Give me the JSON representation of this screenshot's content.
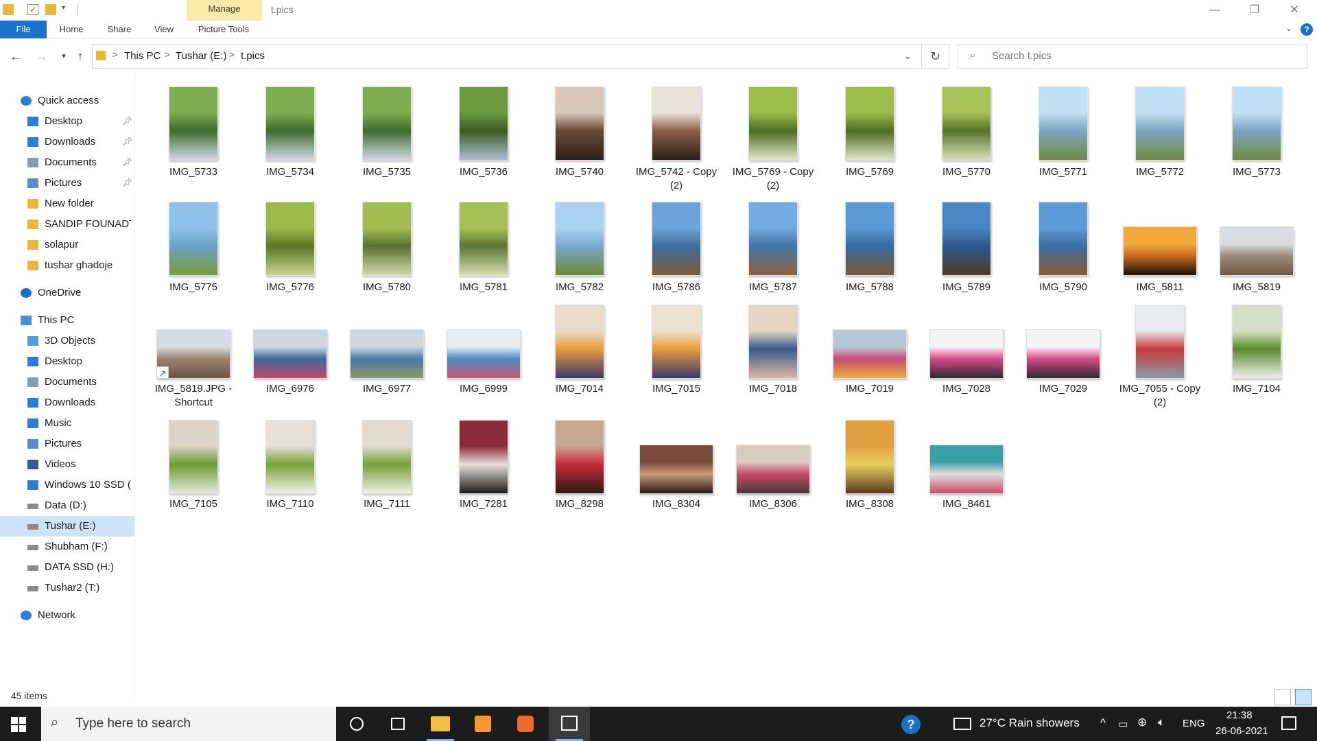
{
  "window": {
    "title": "t.pics",
    "manage_tab": "Manage",
    "controls": {
      "minimize": "—",
      "restore": "❐",
      "close": "✕"
    }
  },
  "ribbon": {
    "tabs": [
      "File",
      "Home",
      "Share",
      "View",
      "Picture Tools"
    ],
    "help": "?"
  },
  "address": {
    "crumbs": [
      "This PC",
      "Tushar (E:)",
      "t.pics"
    ],
    "separator": ">",
    "search_placeholder": "Search t.pics"
  },
  "sidebar": {
    "items": [
      {
        "label": "Quick access",
        "icon": "star-icon",
        "pinned": false
      },
      {
        "label": "Desktop",
        "icon": "desktop-icon",
        "pinned": true
      },
      {
        "label": "Downloads",
        "icon": "download-icon",
        "pinned": true
      },
      {
        "label": "Documents",
        "icon": "document-icon",
        "pinned": true
      },
      {
        "label": "Pictures",
        "icon": "pictures-icon",
        "pinned": true
      },
      {
        "label": "New folder",
        "icon": "folder-icon",
        "pinned": false
      },
      {
        "label": "SANDIP FOUNADTI(",
        "icon": "folder-icon",
        "pinned": false
      },
      {
        "label": "solapur",
        "icon": "folder-icon",
        "pinned": false
      },
      {
        "label": "tushar ghadoje",
        "icon": "folder-icon",
        "pinned": false
      },
      {
        "label": "OneDrive",
        "icon": "cloud-icon",
        "pinned": false
      },
      {
        "label": "This PC",
        "icon": "computer-icon",
        "pinned": false
      },
      {
        "label": "3D Objects",
        "icon": "cube-icon",
        "pinned": false
      },
      {
        "label": "Desktop",
        "icon": "desktop-icon",
        "pinned": false
      },
      {
        "label": "Documents",
        "icon": "document-icon",
        "pinned": false
      },
      {
        "label": "Downloads",
        "icon": "download-icon",
        "pinned": false
      },
      {
        "label": "Music",
        "icon": "music-icon",
        "pinned": false
      },
      {
        "label": "Pictures",
        "icon": "pictures-icon",
        "pinned": false
      },
      {
        "label": "Videos",
        "icon": "video-icon",
        "pinned": false
      },
      {
        "label": "Windows 10 SSD (C",
        "icon": "windows-drive-icon",
        "pinned": false
      },
      {
        "label": "Data (D:)",
        "icon": "drive-icon",
        "pinned": false
      },
      {
        "label": "Tushar (E:)",
        "icon": "drive-icon",
        "pinned": false
      },
      {
        "label": "Shubham (F:)",
        "icon": "drive-icon",
        "pinned": false
      },
      {
        "label": "DATA SSD (H:)",
        "icon": "drive-icon",
        "pinned": false
      },
      {
        "label": "Tushar2 (T:)",
        "icon": "drive-icon",
        "pinned": false
      },
      {
        "label": "Network",
        "icon": "network-icon",
        "pinned": false
      }
    ],
    "selected": "Tushar (E:)"
  },
  "files": [
    {
      "name": "IMG_5733",
      "shape": "portrait",
      "colors": [
        "#7fae52",
        "#3f6b2b",
        "#cfd9e6"
      ]
    },
    {
      "name": "IMG_5734",
      "shape": "portrait",
      "colors": [
        "#7fae52",
        "#3f6b2b",
        "#cfd9e6"
      ]
    },
    {
      "name": "IMG_5735",
      "shape": "portrait",
      "colors": [
        "#7fae52",
        "#3f6b2b",
        "#cfd9e6"
      ]
    },
    {
      "name": "IMG_5736",
      "shape": "portrait",
      "colors": [
        "#6b9a3e",
        "#3b5d24",
        "#a9bcd0"
      ]
    },
    {
      "name": "IMG_5740",
      "shape": "portrait",
      "colors": [
        "#d8c8b8",
        "#6a4a38",
        "#2a1e18"
      ]
    },
    {
      "name": "IMG_5742 - Copy (2)",
      "shape": "portrait",
      "colors": [
        "#e9e4da",
        "#8a6048",
        "#2c211a"
      ]
    },
    {
      "name": "IMG_5769 - Copy (2)",
      "shape": "portrait",
      "colors": [
        "#9dbd4a",
        "#4f6b22",
        "#e1e6c6"
      ]
    },
    {
      "name": "IMG_5769",
      "shape": "portrait",
      "colors": [
        "#9dbd4a",
        "#4f6b22",
        "#e1e6c6"
      ]
    },
    {
      "name": "IMG_5770",
      "shape": "portrait",
      "colors": [
        "#a7c256",
        "#55722a",
        "#d9e0b8"
      ]
    },
    {
      "name": "IMG_5771",
      "shape": "portrait",
      "colors": [
        "#bfe0f6",
        "#7fa5c2",
        "#6a8a3c"
      ]
    },
    {
      "name": "IMG_5772",
      "shape": "portrait",
      "colors": [
        "#bfe0f6",
        "#7fa5c2",
        "#6a8a3c"
      ]
    },
    {
      "name": "IMG_5773",
      "shape": "portrait",
      "colors": [
        "#bfe0f6",
        "#7fa5c2",
        "#6a8a3c"
      ]
    },
    {
      "name": "IMG_5775",
      "shape": "portrait",
      "colors": [
        "#8fc2ea",
        "#6aa0c8",
        "#7a9a3a"
      ]
    },
    {
      "name": "IMG_5776",
      "shape": "portrait",
      "colors": [
        "#9fb84a",
        "#5e7328",
        "#c9d48e"
      ]
    },
    {
      "name": "IMG_5780",
      "shape": "portrait",
      "colors": [
        "#a4bc52",
        "#5a7030",
        "#d1d9a8"
      ]
    },
    {
      "name": "IMG_5781",
      "shape": "portrait",
      "colors": [
        "#a8bf58",
        "#5c7532",
        "#d8dfae"
      ]
    },
    {
      "name": "IMG_5782",
      "shape": "portrait",
      "colors": [
        "#aad3f1",
        "#79a8cc",
        "#6c8a34"
      ]
    },
    {
      "name": "IMG_5786",
      "shape": "portrait",
      "colors": [
        "#6da4da",
        "#3d6e9e",
        "#7a5a3a"
      ]
    },
    {
      "name": "IMG_5787",
      "shape": "portrait",
      "colors": [
        "#74abe0",
        "#4276a8",
        "#8a6240"
      ]
    },
    {
      "name": "IMG_5788",
      "shape": "portrait",
      "colors": [
        "#5c98d4",
        "#346aa0",
        "#7a5836"
      ]
    },
    {
      "name": "IMG_5789",
      "shape": "portrait",
      "colors": [
        "#4d86c4",
        "#2b5a8e",
        "#4a3a22"
      ]
    },
    {
      "name": "IMG_5790",
      "shape": "portrait",
      "colors": [
        "#5d9ad8",
        "#3a6ca2",
        "#8a5a30"
      ]
    },
    {
      "name": "IMG_5811",
      "shape": "landscape",
      "colors": [
        "#f2a93c",
        "#c76a1e",
        "#1a1208"
      ]
    },
    {
      "name": "IMG_5819",
      "shape": "landscape",
      "colors": [
        "#d9dde3",
        "#9a8a78",
        "#6c5a46"
      ]
    },
    {
      "name": "IMG_5819.JPG - Shortcut",
      "shape": "landscape",
      "shortcut": true,
      "colors": [
        "#d6dbe1",
        "#9a8470",
        "#6a5542"
      ]
    },
    {
      "name": "IMG_6976",
      "shape": "landscape",
      "colors": [
        "#cfd6dd",
        "#3a6a9a",
        "#c04a6a"
      ]
    },
    {
      "name": "IMG_6977",
      "shape": "landscape",
      "colors": [
        "#cfd6dd",
        "#4a7aa8",
        "#8a9a6a"
      ]
    },
    {
      "name": "IMG_6999",
      "shape": "landscape",
      "colors": [
        "#e6ecef",
        "#4a8ac0",
        "#c85a7a"
      ]
    },
    {
      "name": "IMG_7014",
      "shape": "portrait",
      "colors": [
        "#e8dccc",
        "#e89a3a",
        "#3a3a6a"
      ]
    },
    {
      "name": "IMG_7015",
      "shape": "portrait",
      "colors": [
        "#ece2d2",
        "#e89a3a",
        "#3a3a6a"
      ]
    },
    {
      "name": "IMG_7018",
      "shape": "portrait",
      "colors": [
        "#e4d6c4",
        "#3a5a8a",
        "#d8b8a0"
      ]
    },
    {
      "name": "IMG_7019",
      "shape": "landscape",
      "colors": [
        "#b8c8d4",
        "#c84a7a",
        "#e8b03a"
      ]
    },
    {
      "name": "IMG_7028",
      "shape": "landscape",
      "colors": [
        "#f4f4f4",
        "#d84a8a",
        "#2a2a2a"
      ]
    },
    {
      "name": "IMG_7029",
      "shape": "landscape",
      "colors": [
        "#f4f4f4",
        "#d84a8a",
        "#2a2a2a"
      ]
    },
    {
      "name": "IMG_7055 - Copy (2)",
      "shape": "portrait",
      "colors": [
        "#e8ecee",
        "#c83a3a",
        "#8a9aa8"
      ]
    },
    {
      "name": "IMG_7104",
      "shape": "portrait",
      "colors": [
        "#d6e0c8",
        "#5a8a2a",
        "#f0f0ea"
      ]
    },
    {
      "name": "IMG_7105",
      "shape": "portrait",
      "colors": [
        "#dcd4c6",
        "#6a9a2e",
        "#eae6de"
      ]
    },
    {
      "name": "IMG_7110",
      "shape": "portrait",
      "colors": [
        "#e6e0d6",
        "#7aa038",
        "#f4f0ea"
      ]
    },
    {
      "name": "IMG_7111",
      "shape": "portrait",
      "colors": [
        "#e2dcd0",
        "#78a036",
        "#f2eee6"
      ]
    },
    {
      "name": "IMG_7281",
      "shape": "portrait",
      "colors": [
        "#8a2a3a",
        "#e8e0dc",
        "#1a1a1a"
      ]
    },
    {
      "name": "IMG_8298",
      "shape": "portrait",
      "colors": [
        "#c8a890",
        "#c82a3a",
        "#2a1a14"
      ]
    },
    {
      "name": "IMG_8304",
      "shape": "landscape",
      "colors": [
        "#7a4a3a",
        "#c89a7a",
        "#2a1a14"
      ]
    },
    {
      "name": "IMG_8306",
      "shape": "landscape",
      "colors": [
        "#d8ccc0",
        "#c84a6a",
        "#4a3a3a"
      ]
    },
    {
      "name": "IMG_8308",
      "shape": "portrait",
      "colors": [
        "#e0a040",
        "#e8d060",
        "#5a3a20"
      ]
    },
    {
      "name": "IMG_8461",
      "shape": "landscape",
      "colors": [
        "#3aa0a8",
        "#e0e0dc",
        "#c84a6a"
      ]
    }
  ],
  "status": {
    "item_count": "45 items"
  },
  "taskbar": {
    "search_placeholder": "Type here to search",
    "weather": "27°C  Rain showers",
    "language": "ENG",
    "time": "21:38",
    "date": "26-06-2021",
    "apps": [
      "cortana-icon",
      "task-view-icon",
      "file-explorer-icon",
      "sublime-text-icon",
      "xampp-icon",
      "photos-icon"
    ]
  },
  "colors": {
    "accent": "#1a73c8",
    "selected_bg": "#cce4f7",
    "manage_tab_bg": "#fbe9a7",
    "taskbar_bg": "#1c1c1c"
  }
}
